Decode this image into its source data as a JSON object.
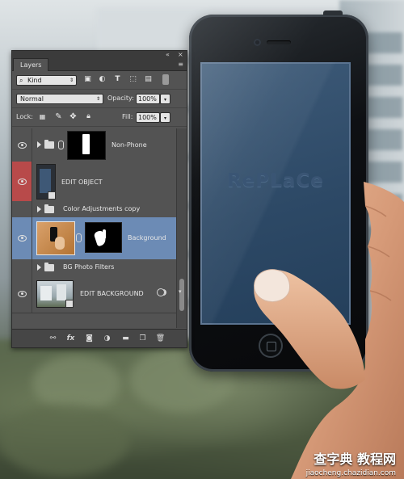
{
  "panel": {
    "tab_label": "Layers",
    "collapse_glyph": "«",
    "close_glyph": "×",
    "menu_glyph": "≡",
    "filter": {
      "value": "Kind"
    },
    "blend_mode": {
      "value": "Normal"
    },
    "opacity": {
      "label": "Opacity:",
      "value": "100%"
    },
    "lock": {
      "label": "Lock:"
    },
    "fill": {
      "label": "Fill:",
      "value": "100%"
    }
  },
  "layers": [
    {
      "name": "Non-Phone",
      "type": "group",
      "expanded": false,
      "visible": true,
      "has_mask": true,
      "selected": false
    },
    {
      "name": "EDIT OBJECT",
      "type": "smart-object",
      "visible": true,
      "visibility_highlight": "#b84a4a",
      "selected": false
    },
    {
      "name": "Color Adjustments copy",
      "type": "group",
      "expanded": false,
      "visible": false,
      "selected": false
    },
    {
      "name": "Background",
      "type": "pixel-with-mask",
      "visible": true,
      "selected": true,
      "selection_color": "#6c8bb5"
    },
    {
      "name": "BG Photo Filters",
      "type": "group",
      "expanded": false,
      "visible": false,
      "selected": false
    },
    {
      "name": "EDIT BACKGROUND",
      "type": "smart-object",
      "visible": true,
      "selected": false
    }
  ],
  "footer_icons": [
    "link-icon",
    "fx-icon",
    "mask-icon",
    "adjustment-icon",
    "folder-icon",
    "new-layer-icon",
    "trash-icon"
  ],
  "footer_glyphs": {
    "fx": "fx"
  },
  "canvas": {
    "screen_text": "RePLaCe",
    "screen_color": "#2d4966"
  },
  "watermark": {
    "line1": "查字典 教程网",
    "line2": "jiaocheng.chazidian.com"
  }
}
